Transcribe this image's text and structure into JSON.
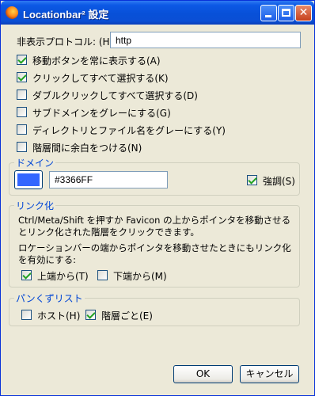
{
  "window": {
    "title": "Locationbar² 設定"
  },
  "protocol": {
    "label": "非表示プロトコル: (H)",
    "value": "http"
  },
  "options": [
    {
      "label": "移動ボタンを常に表示する(A)",
      "checked": true
    },
    {
      "label": "クリックしてすべて選択する(K)",
      "checked": true
    },
    {
      "label": "ダブルクリックしてすべて選択する(D)",
      "checked": false
    },
    {
      "label": "サブドメインをグレーにする(G)",
      "checked": false
    },
    {
      "label": "ディレクトリとファイル名をグレーにする(Y)",
      "checked": false
    },
    {
      "label": "階層間に余白をつける(N)",
      "checked": false
    }
  ],
  "domain_group": {
    "title": "ドメイン",
    "color_value": "#3366FF",
    "swatch_color": "#3366FF",
    "emphasis_label": "強調(S)",
    "emphasis_checked": true
  },
  "link_group": {
    "title": "リンク化",
    "desc1": "Ctrl/Meta/Shift を押すか Favicon の上からポインタを移動させるとリンク化された階層をクリックできます。",
    "desc2": "ロケーションバーの端からポインタを移動させたときにもリンク化を有効にする:",
    "top_label": "上端から(T)",
    "top_checked": true,
    "bottom_label": "下端から(M)",
    "bottom_checked": false
  },
  "breadcrumb_group": {
    "title": "パンくずリスト",
    "host_label": "ホスト(H)",
    "host_checked": false,
    "level_label": "階層ごと(E)",
    "level_checked": true
  },
  "buttons": {
    "ok": "OK",
    "cancel": "キャンセル"
  }
}
